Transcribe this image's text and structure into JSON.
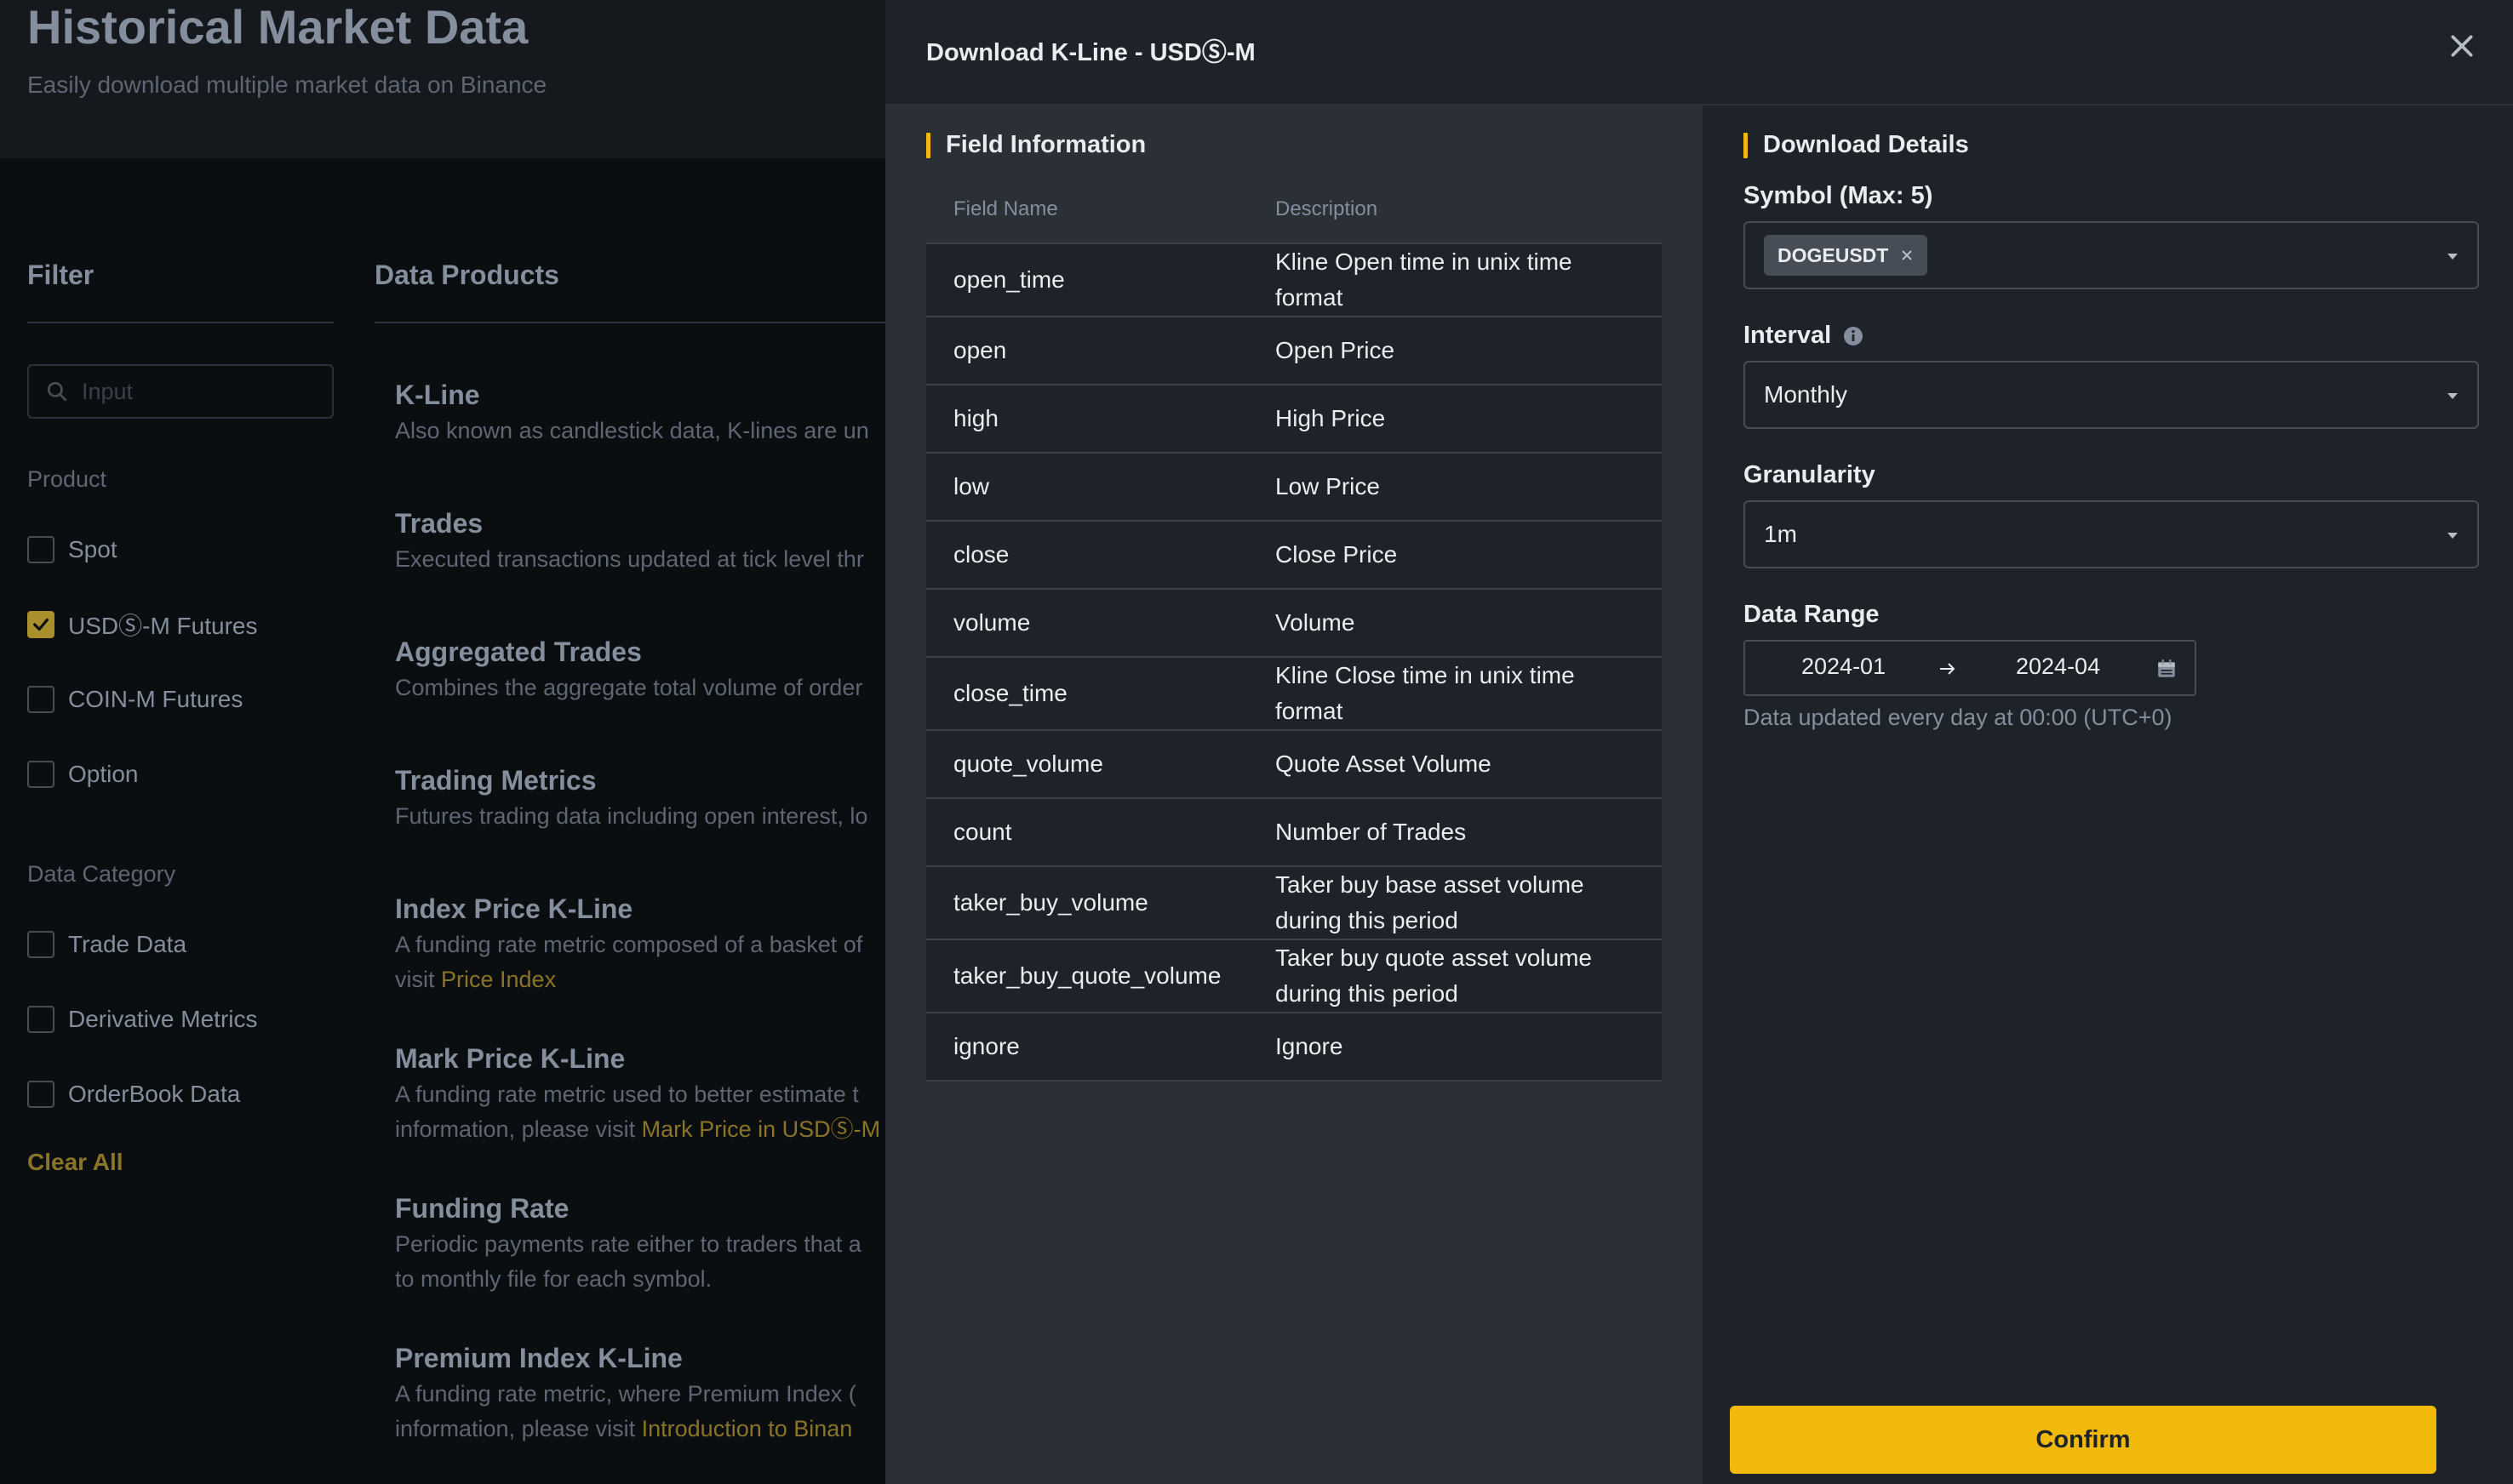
{
  "page": {
    "title": "Historical Market Data",
    "subtitle": "Easily download multiple market data on Binance"
  },
  "filter": {
    "heading": "Filter",
    "search_placeholder": "Input",
    "product_label": "Product",
    "products": [
      {
        "label": "Spot",
        "checked": false
      },
      {
        "label": "USDⓈ-M Futures",
        "checked": true
      },
      {
        "label": "COIN-M Futures",
        "checked": false
      },
      {
        "label": "Option",
        "checked": false
      }
    ],
    "category_label": "Data Category",
    "categories": [
      {
        "label": "Trade Data",
        "checked": false
      },
      {
        "label": "Derivative Metrics",
        "checked": false
      },
      {
        "label": "OrderBook Data",
        "checked": false
      }
    ],
    "clear_all": "Clear All"
  },
  "data_products": {
    "heading": "Data Products",
    "items": [
      {
        "title": "K-Line",
        "desc_1": "Also known as candlestick data, K-lines are un",
        "desc_2": "",
        "link": ""
      },
      {
        "title": "Trades",
        "desc_1": "Executed transactions updated at tick level thr",
        "desc_2": "",
        "link": ""
      },
      {
        "title": "Aggregated Trades",
        "desc_1": "Combines the aggregate total volume of order",
        "desc_2": "",
        "link": ""
      },
      {
        "title": "Trading Metrics",
        "desc_1": "Futures trading data including open interest, lo",
        "desc_2": "",
        "link": ""
      },
      {
        "title": "Index Price K-Line",
        "desc_1": "A funding rate metric composed of a basket of",
        "desc_2": "visit ",
        "link": "Price Index"
      },
      {
        "title": "Mark Price K-Line",
        "desc_1": "A funding rate metric used to better estimate t",
        "desc_2": "information, please visit ",
        "link": "Mark Price in USDⓈ-M"
      },
      {
        "title": "Funding Rate",
        "desc_1": "Periodic payments rate either to traders that a",
        "desc_2": "to monthly file for each symbol.",
        "link": ""
      },
      {
        "title": "Premium Index K-Line",
        "desc_1": "A funding rate metric, where Premium Index (",
        "desc_2": "information, please visit ",
        "link": "Introduction to Binan"
      }
    ]
  },
  "drawer": {
    "title": "Download K-Line - USDⓈ-M",
    "field_info": {
      "heading": "Field Information",
      "columns": [
        "Field Name",
        "Description"
      ],
      "rows": [
        {
          "name": "open_time",
          "desc": "Kline Open time in unix time format"
        },
        {
          "name": "open",
          "desc": "Open Price"
        },
        {
          "name": "high",
          "desc": "High Price"
        },
        {
          "name": "low",
          "desc": "Low Price"
        },
        {
          "name": "close",
          "desc": "Close Price"
        },
        {
          "name": "volume",
          "desc": "Volume"
        },
        {
          "name": "close_time",
          "desc": "Kline Close time in unix time format"
        },
        {
          "name": "quote_volume",
          "desc": "Quote Asset Volume"
        },
        {
          "name": "count",
          "desc": "Number of Trades"
        },
        {
          "name": "taker_buy_volume",
          "desc": "Taker buy base asset volume during this period"
        },
        {
          "name": "taker_buy_quote_volume",
          "desc": "Taker buy quote asset volume during this period"
        },
        {
          "name": "ignore",
          "desc": "Ignore"
        }
      ]
    },
    "download": {
      "heading": "Download Details",
      "symbol_label": "Symbol (Max: 5)",
      "symbol_tag": "DOGEUSDT",
      "interval_label": "Interval",
      "interval_value": "Monthly",
      "granularity_label": "Granularity",
      "granularity_value": "1m",
      "range_label": "Data Range",
      "range_start": "2024-01",
      "range_end": "2024-04",
      "note": "Data updated every day at 00:00 (UTC+0)",
      "confirm": "Confirm"
    }
  },
  "colors": {
    "accent": "#f0b90b",
    "background": "#0b0e11",
    "drawer": "#1e2329",
    "panel": "#2b2f36"
  },
  "icons": [
    "search-icon",
    "checkmark-icon",
    "close-icon",
    "info-icon",
    "caret-down-icon",
    "tag-remove-icon",
    "arrow-right-icon",
    "calendar-icon"
  ]
}
